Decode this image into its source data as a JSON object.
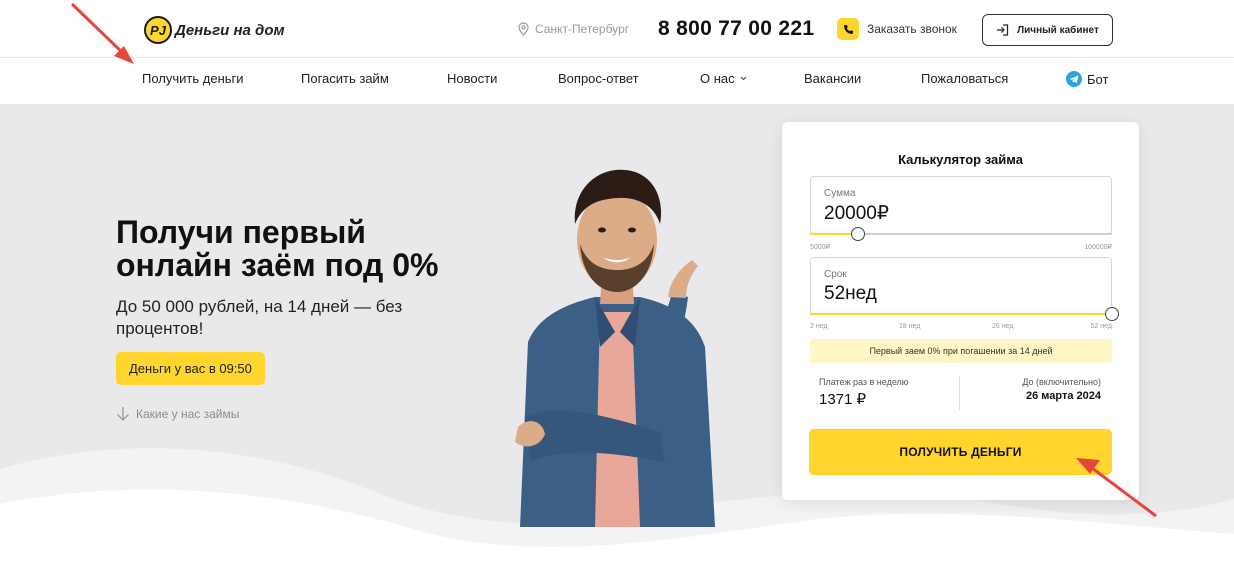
{
  "header": {
    "logo_text": "Деньги на дом",
    "logo_mark": "РJ",
    "city": "Санкт-Петербург",
    "phone": "8 800 77 00 221",
    "callback_label": "Заказать звонок",
    "cabinet_label": "Личный кабинет"
  },
  "nav": {
    "items": [
      {
        "label": "Получить деньги"
      },
      {
        "label": "Погасить займ"
      },
      {
        "label": "Новости"
      },
      {
        "label": "Вопрос-ответ"
      },
      {
        "label": "О нас"
      },
      {
        "label": "Вакансии"
      },
      {
        "label": "Пожаловаться"
      },
      {
        "label": "Бот"
      }
    ]
  },
  "hero": {
    "title": "Получи первый онлайн заём под 0%",
    "subtitle": "До 50 000 рублей, на 14 дней — без процентов!",
    "timer_button": "Деньги у вас в 09:50",
    "scroll_link": "Какие у нас займы"
  },
  "calculator": {
    "title": "Калькулятор займа",
    "amount": {
      "label": "Сумма",
      "value": "20000",
      "currency": "₽",
      "min_label": "5000₽",
      "max_label": "100000₽",
      "min": 5000,
      "max": 100000,
      "current": 20000
    },
    "term": {
      "label": "Срок",
      "value": "52",
      "unit": "нед",
      "ticks": [
        "2 нед",
        "18 нед",
        "26 нед",
        "52 нед"
      ],
      "min": 2,
      "max": 52,
      "current": 52
    },
    "promo": "Первый заем 0% при погашении за 14 дней",
    "weekly_payment_label": "Платеж раз в неделю",
    "weekly_payment_value": "1371 ₽",
    "until_label": "До (включительно)",
    "until_value": "26 марта 2024",
    "cta_label": "ПОЛУЧИТЬ ДЕНЬГИ"
  },
  "colors": {
    "accent": "#ffd52e",
    "hero_bg": "#e9e9ec",
    "annotation_arrow": "#e8453c",
    "telegram": "#2aa3e0"
  }
}
